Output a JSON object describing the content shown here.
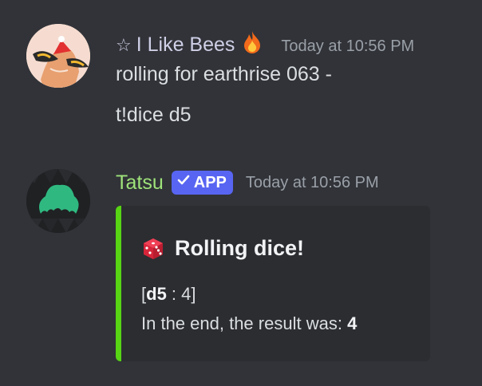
{
  "messages": [
    {
      "username": "I Like Bees",
      "username_prefix": "☆",
      "status_emoji": "fire-emoji",
      "timestamp": "Today at 10:56 PM",
      "lines": [
        "rolling for earthrise 063 -",
        "t!dice d5"
      ]
    },
    {
      "username": "Tatsu",
      "badge": "APP",
      "timestamp": "Today at 10:56 PM",
      "embed": {
        "accent_color": "#57d414",
        "title": "Rolling dice!",
        "title_icon": "dice-icon",
        "dice_type": "d5",
        "roll_value": "4",
        "result_label": "In the end, the result was:",
        "result_value": "4"
      }
    }
  ],
  "colors": {
    "background": "#313338",
    "embed_background": "#2b2d31",
    "app_badge": "#5865f2",
    "tatsu_name": "#9fe37a"
  }
}
